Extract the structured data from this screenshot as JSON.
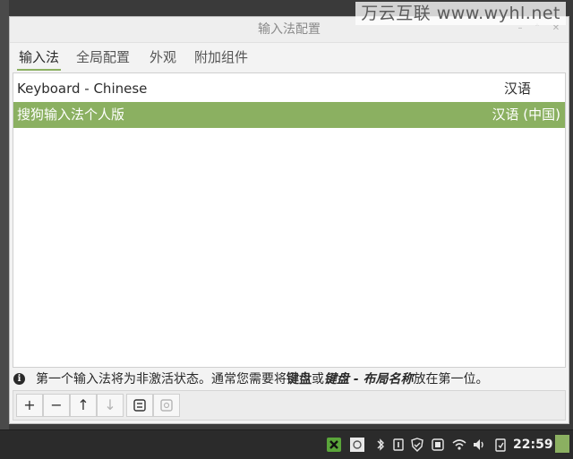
{
  "watermark": "万云互联 www.wyhl.net",
  "window": {
    "title": "输入法配置"
  },
  "tabs": [
    {
      "label": "输入法"
    },
    {
      "label": "全局配置"
    },
    {
      "label": "外观"
    },
    {
      "label": "附加组件"
    }
  ],
  "input_methods": [
    {
      "name": "Keyboard - Chinese",
      "language": "汉语"
    },
    {
      "name": "搜狗输入法个人版",
      "language": "汉语 (中国)"
    }
  ],
  "info": {
    "part1": "第一个输入法将为非激活状态。通常您需要将",
    "key1": "键盘",
    "part2": "或",
    "key2": "键盘 - 布局名称",
    "part3": "放在第一位。"
  },
  "toolbar": {
    "add": "+",
    "remove": "−",
    "up": "↑",
    "down": "↓"
  },
  "taskbar": {
    "clock": "22:59"
  },
  "colors": {
    "accent": "#8bb061",
    "taskbar": "#2b2b2b"
  }
}
